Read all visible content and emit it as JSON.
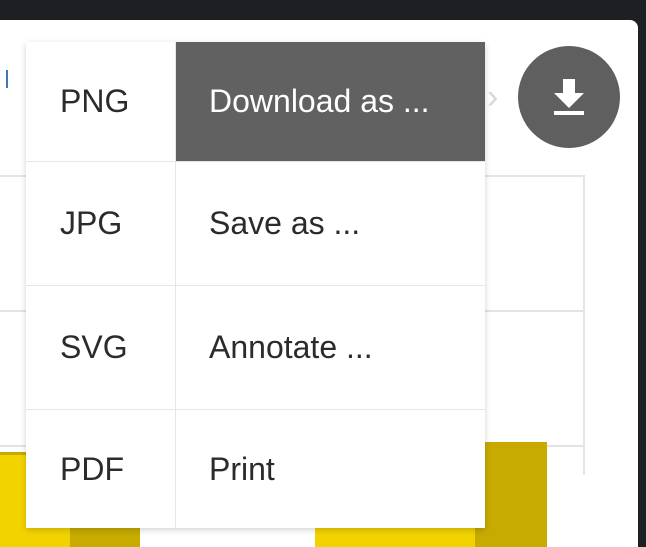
{
  "export_menu": {
    "formats": [
      {
        "label": "PNG"
      },
      {
        "label": "JPG"
      },
      {
        "label": "SVG"
      },
      {
        "label": "PDF"
      }
    ],
    "actions": [
      {
        "label": "Download as ...",
        "active": true
      },
      {
        "label": "Save as ..."
      },
      {
        "label": "Annotate ..."
      },
      {
        "label": "Print"
      }
    ]
  },
  "download_button": {
    "icon": "download-icon"
  },
  "colors": {
    "active_item_bg": "#616161",
    "chart_bar": "#f2d300",
    "fab_bg": "#5f5f5f"
  }
}
